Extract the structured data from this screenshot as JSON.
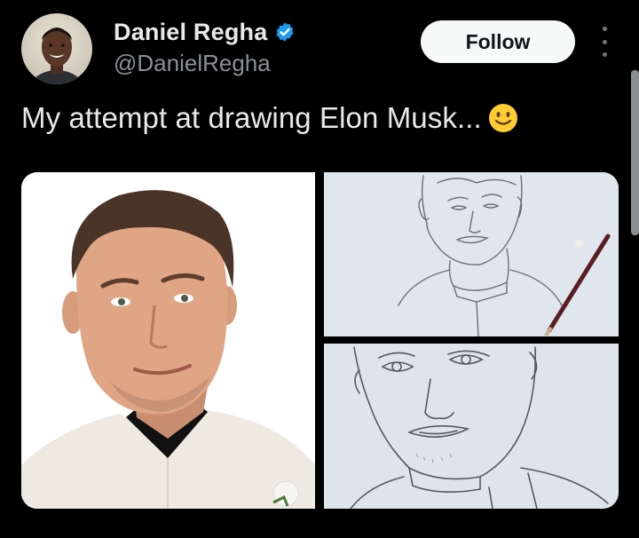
{
  "author": {
    "display_name": "Daniel Regha",
    "handle": "@DanielRegha",
    "verified": true,
    "avatar_icon": "profile-photo"
  },
  "follow_label": "Follow",
  "tweet_text": "My attempt at drawing Elon Musk...",
  "emoji": "slightly-smiling-face",
  "media": [
    {
      "kind": "photo",
      "description_icon": "portrait-photo"
    },
    {
      "kind": "pencil-sketch",
      "description_icon": "sketch-image"
    },
    {
      "kind": "pencil-sketch",
      "description_icon": "sketch-image"
    }
  ],
  "colors": {
    "background": "#000000",
    "text": "#e7e9ea",
    "secondary_text": "#8b9096",
    "verified_blue": "#1d9bf0",
    "follow_button_bg": "#f7f9f9"
  }
}
